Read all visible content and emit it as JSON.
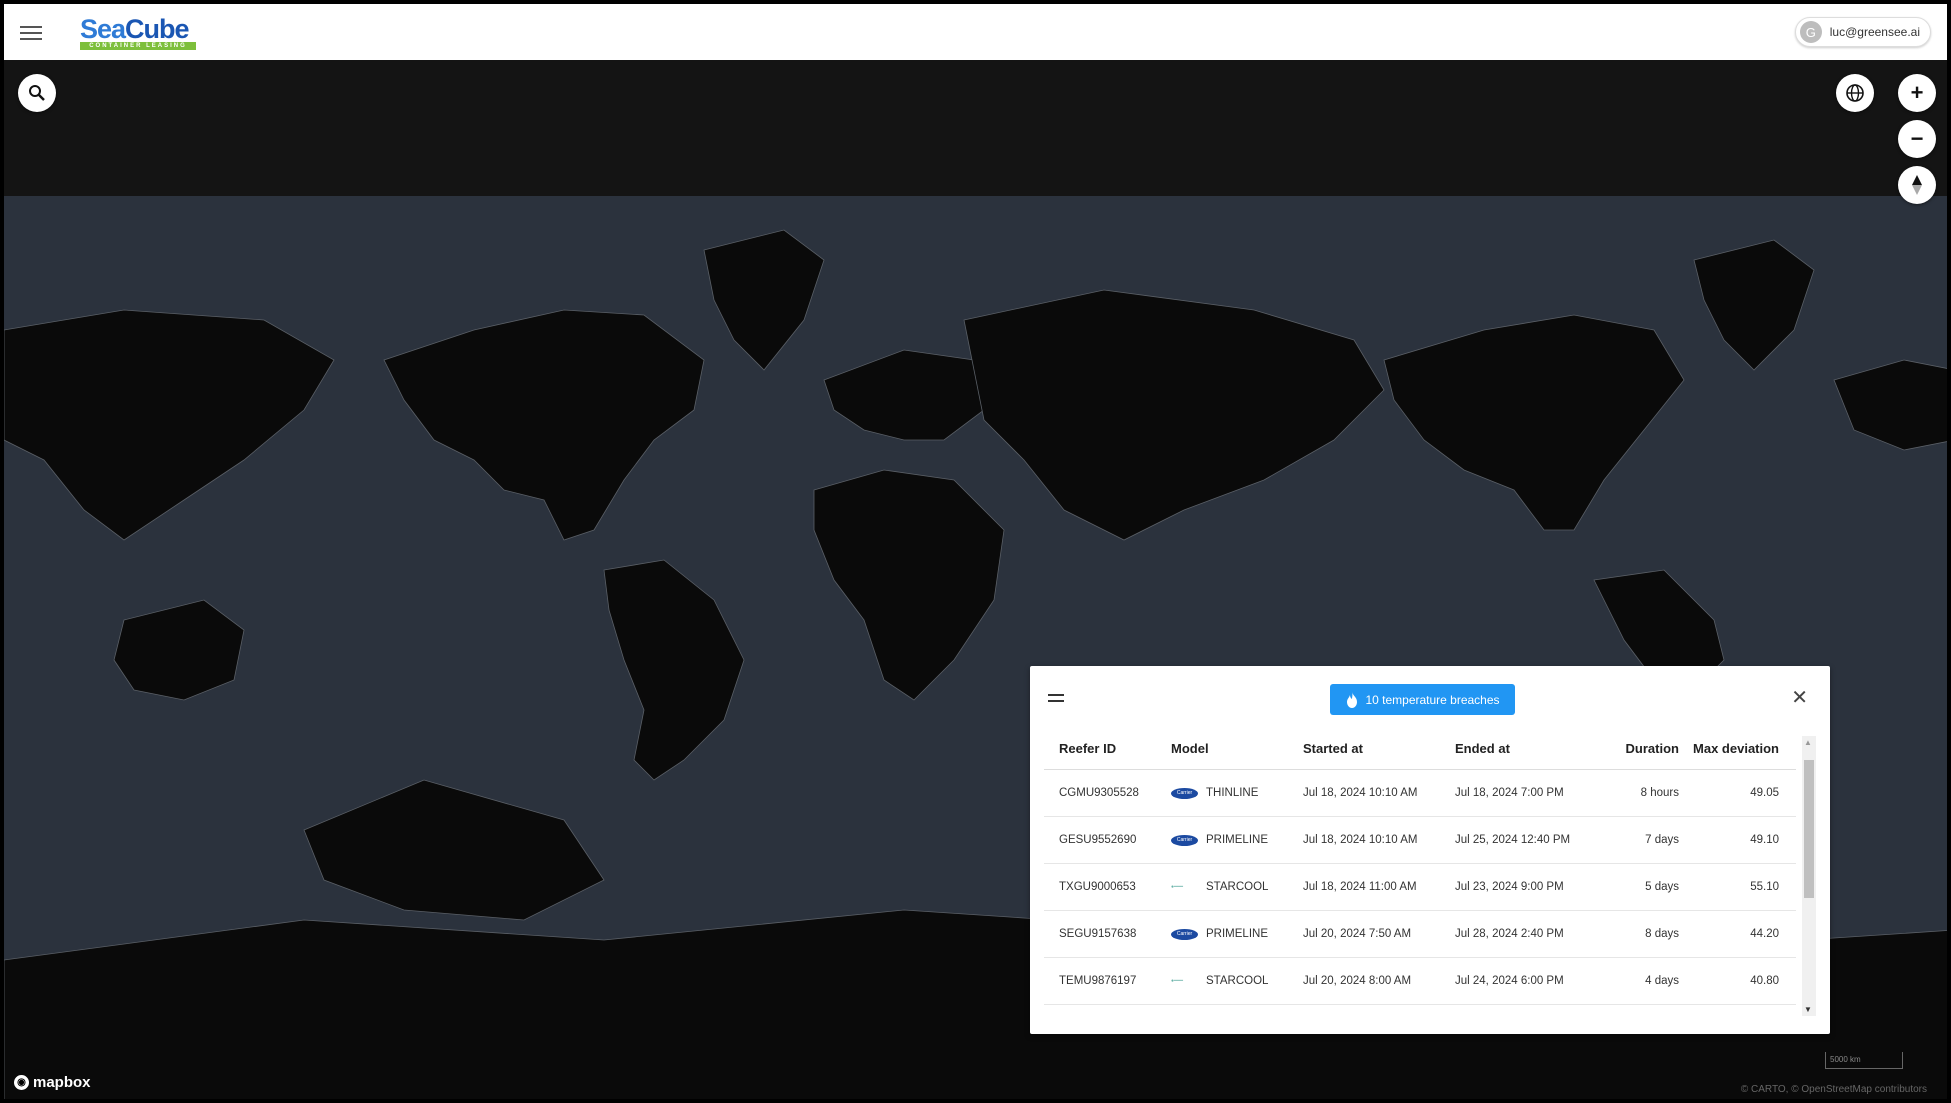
{
  "header": {
    "menu_icon": "hamburger-icon",
    "logo": {
      "name": "SeaCube",
      "part1": "Sea",
      "part2": "Cube",
      "tagline": "CONTAINER LEASING"
    },
    "user": {
      "initial": "G",
      "email": "luc@greensee.ai"
    }
  },
  "map": {
    "controls": {
      "search_icon": "search-icon",
      "globe_icon": "globe-icon",
      "zoom_in_label": "+",
      "zoom_out_label": "−",
      "compass_icon": "compass-icon"
    },
    "attribution": {
      "brand": "mapbox",
      "copyright": "© CARTO, © OpenStreetMap contributors"
    },
    "scale_label": "5000 km",
    "colors": {
      "land": "#0a0a0a",
      "water": "#2b323d",
      "accent": "#2196f3"
    }
  },
  "breaches_panel": {
    "badge_label": "10 temperature breaches",
    "columns": [
      "Reefer ID",
      "Model",
      "Started at",
      "Ended at",
      "Duration",
      "Max deviation"
    ],
    "rows": [
      {
        "id": "CGMU9305528",
        "brand": "carrier",
        "model": "THINLINE",
        "started": "Jul 18, 2024 10:10 AM",
        "ended": "Jul 18, 2024 7:00 PM",
        "duration": "8 hours",
        "max_deviation": "49.05"
      },
      {
        "id": "GESU9552690",
        "brand": "carrier",
        "model": "PRIMELINE",
        "started": "Jul 18, 2024 10:10 AM",
        "ended": "Jul 25, 2024 12:40 PM",
        "duration": "7 days",
        "max_deviation": "49.10"
      },
      {
        "id": "TXGU9000653",
        "brand": "starcool",
        "model": "STARCOOL",
        "started": "Jul 18, 2024 11:00 AM",
        "ended": "Jul 23, 2024 9:00 PM",
        "duration": "5 days",
        "max_deviation": "55.10"
      },
      {
        "id": "SEGU9157638",
        "brand": "carrier",
        "model": "PRIMELINE",
        "started": "Jul 20, 2024 7:50 AM",
        "ended": "Jul 28, 2024 2:40 PM",
        "duration": "8 days",
        "max_deviation": "44.20"
      },
      {
        "id": "TEMU9876197",
        "brand": "starcool",
        "model": "STARCOOL",
        "started": "Jul 20, 2024 8:00 AM",
        "ended": "Jul 24, 2024 6:00 PM",
        "duration": "4 days",
        "max_deviation": "40.80"
      }
    ]
  }
}
